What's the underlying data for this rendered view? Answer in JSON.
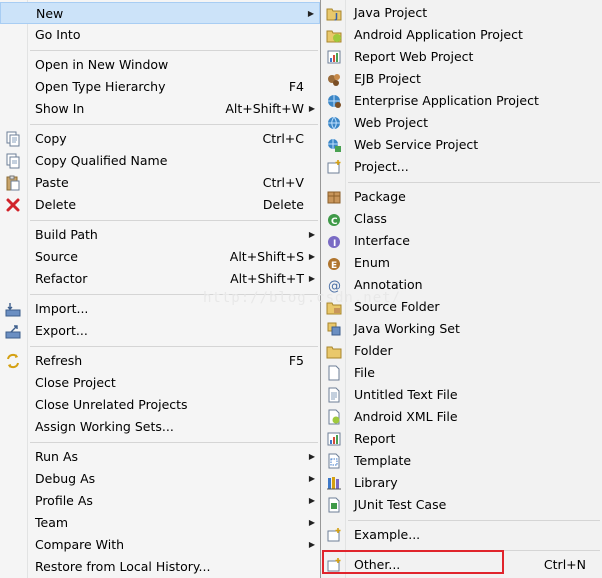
{
  "colors": {
    "menu_bg": "#f5f5f5",
    "highlight_bg": "#cce3f9",
    "highlight_border": "#a8cdf3",
    "callout": "#e0242c"
  },
  "context_menu": {
    "items": [
      {
        "label": "New",
        "shortcut": "",
        "submenu": true,
        "icon": "",
        "highlighted": true
      },
      {
        "label": "Go Into",
        "shortcut": "",
        "submenu": false,
        "icon": ""
      },
      {
        "label": "Open in New Window",
        "shortcut": "",
        "submenu": false,
        "icon": ""
      },
      {
        "label": "Open Type Hierarchy",
        "shortcut": "F4",
        "submenu": false,
        "icon": ""
      },
      {
        "label": "Show In",
        "shortcut": "Alt+Shift+W",
        "submenu": true,
        "icon": ""
      },
      {
        "label": "Copy",
        "shortcut": "Ctrl+C",
        "submenu": false,
        "icon": "copy-icon"
      },
      {
        "label": "Copy Qualified Name",
        "shortcut": "",
        "submenu": false,
        "icon": "copy-qualified-name-icon"
      },
      {
        "label": "Paste",
        "shortcut": "Ctrl+V",
        "submenu": false,
        "icon": "paste-icon"
      },
      {
        "label": "Delete",
        "shortcut": "Delete",
        "submenu": false,
        "icon": "delete-icon"
      },
      {
        "label": "Build Path",
        "shortcut": "",
        "submenu": true,
        "icon": ""
      },
      {
        "label": "Source",
        "shortcut": "Alt+Shift+S",
        "submenu": true,
        "icon": ""
      },
      {
        "label": "Refactor",
        "shortcut": "Alt+Shift+T",
        "submenu": true,
        "icon": ""
      },
      {
        "label": "Import...",
        "shortcut": "",
        "submenu": false,
        "icon": "import-icon"
      },
      {
        "label": "Export...",
        "shortcut": "",
        "submenu": false,
        "icon": "export-icon"
      },
      {
        "label": "Refresh",
        "shortcut": "F5",
        "submenu": false,
        "icon": "refresh-icon"
      },
      {
        "label": "Close Project",
        "shortcut": "",
        "submenu": false,
        "icon": ""
      },
      {
        "label": "Close Unrelated Projects",
        "shortcut": "",
        "submenu": false,
        "icon": ""
      },
      {
        "label": "Assign Working Sets...",
        "shortcut": "",
        "submenu": false,
        "icon": ""
      },
      {
        "label": "Run As",
        "shortcut": "",
        "submenu": true,
        "icon": ""
      },
      {
        "label": "Debug As",
        "shortcut": "",
        "submenu": true,
        "icon": ""
      },
      {
        "label": "Profile As",
        "shortcut": "",
        "submenu": true,
        "icon": ""
      },
      {
        "label": "Team",
        "shortcut": "",
        "submenu": true,
        "icon": ""
      },
      {
        "label": "Compare With",
        "shortcut": "",
        "submenu": true,
        "icon": ""
      },
      {
        "label": "Restore from Local History...",
        "shortcut": "",
        "submenu": false,
        "icon": ""
      }
    ]
  },
  "new_submenu": {
    "items": [
      {
        "label": "Java Project",
        "shortcut": "",
        "icon": "java-project-icon"
      },
      {
        "label": "Android Application Project",
        "shortcut": "",
        "icon": "android-project-icon"
      },
      {
        "label": "Report Web Project",
        "shortcut": "",
        "icon": "report-web-project-icon"
      },
      {
        "label": "EJB Project",
        "shortcut": "",
        "icon": "ejb-project-icon"
      },
      {
        "label": "Enterprise Application Project",
        "shortcut": "",
        "icon": "enterprise-app-project-icon"
      },
      {
        "label": "Web Project",
        "shortcut": "",
        "icon": "web-project-icon"
      },
      {
        "label": "Web Service Project",
        "shortcut": "",
        "icon": "web-service-project-icon"
      },
      {
        "label": "Project...",
        "shortcut": "",
        "icon": "project-icon"
      },
      {
        "label": "Package",
        "shortcut": "",
        "icon": "package-icon"
      },
      {
        "label": "Class",
        "shortcut": "",
        "icon": "class-icon"
      },
      {
        "label": "Interface",
        "shortcut": "",
        "icon": "interface-icon"
      },
      {
        "label": "Enum",
        "shortcut": "",
        "icon": "enum-icon"
      },
      {
        "label": "Annotation",
        "shortcut": "",
        "icon": "annotation-icon"
      },
      {
        "label": "Source Folder",
        "shortcut": "",
        "icon": "source-folder-icon"
      },
      {
        "label": "Java Working Set",
        "shortcut": "",
        "icon": "working-set-icon"
      },
      {
        "label": "Folder",
        "shortcut": "",
        "icon": "folder-icon"
      },
      {
        "label": "File",
        "shortcut": "",
        "icon": "file-icon"
      },
      {
        "label": "Untitled Text File",
        "shortcut": "",
        "icon": "text-file-icon"
      },
      {
        "label": "Android XML File",
        "shortcut": "",
        "icon": "android-xml-file-icon"
      },
      {
        "label": "Report",
        "shortcut": "",
        "icon": "report-icon"
      },
      {
        "label": "Template",
        "shortcut": "",
        "icon": "template-icon"
      },
      {
        "label": "Library",
        "shortcut": "",
        "icon": "library-icon"
      },
      {
        "label": "JUnit Test Case",
        "shortcut": "",
        "icon": "junit-icon"
      },
      {
        "label": "Example...",
        "shortcut": "",
        "icon": "example-icon"
      },
      {
        "label": "Other...",
        "shortcut": "Ctrl+N",
        "icon": "other-wizard-icon"
      }
    ]
  },
  "watermark": "http://blog.csdn.net/"
}
